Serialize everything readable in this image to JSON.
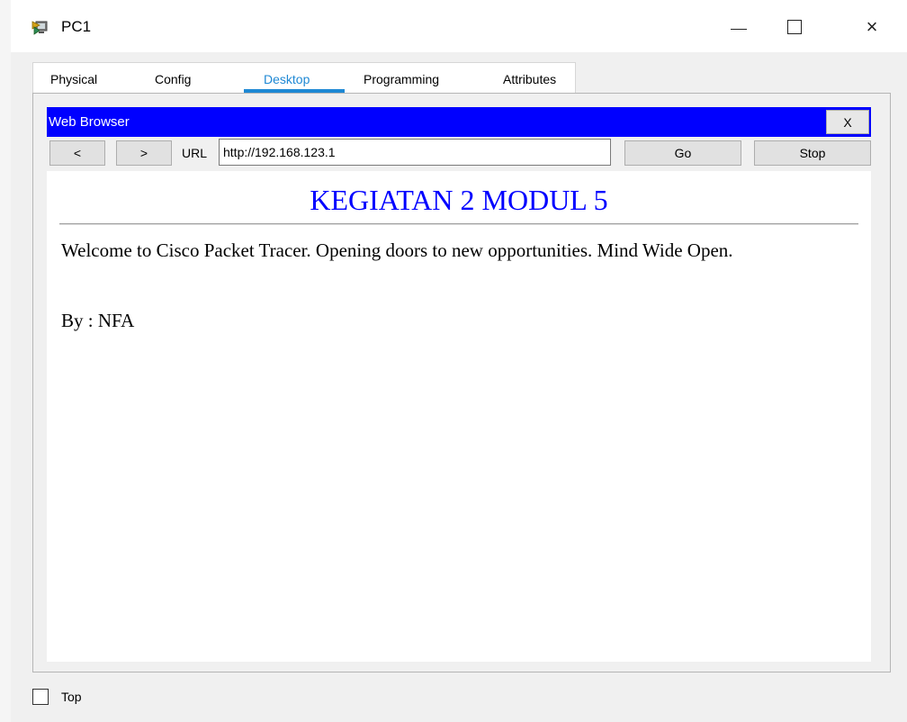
{
  "window": {
    "title": "PC1",
    "close_glyph": "×"
  },
  "tabs": [
    {
      "label": "Physical",
      "active": false
    },
    {
      "label": "Config",
      "active": false
    },
    {
      "label": "Desktop",
      "active": true
    },
    {
      "label": "Programming",
      "active": false
    },
    {
      "label": "Attributes",
      "active": false
    }
  ],
  "browser": {
    "title": "Web Browser",
    "close_label": "X",
    "back_label": "<",
    "forward_label": ">",
    "url_label": "URL",
    "url_value": "http://192.168.123.1",
    "go_label": "Go",
    "stop_label": "Stop"
  },
  "page": {
    "heading": "KEGIATAN 2 MODUL 5",
    "paragraph": "Welcome to Cisco Packet Tracer. Opening doors to new opportunities. Mind Wide Open.",
    "byline": "By : NFA"
  },
  "footer": {
    "top_label": "Top",
    "top_checked": false
  },
  "colors": {
    "browser_titlebar": "#0000ff",
    "heading": "#0000ff",
    "active_tab": "#1e88d4"
  },
  "icons": {
    "app": "pc-icon",
    "minimize": "minimize-icon",
    "maximize": "maximize-icon",
    "close": "close-icon"
  }
}
